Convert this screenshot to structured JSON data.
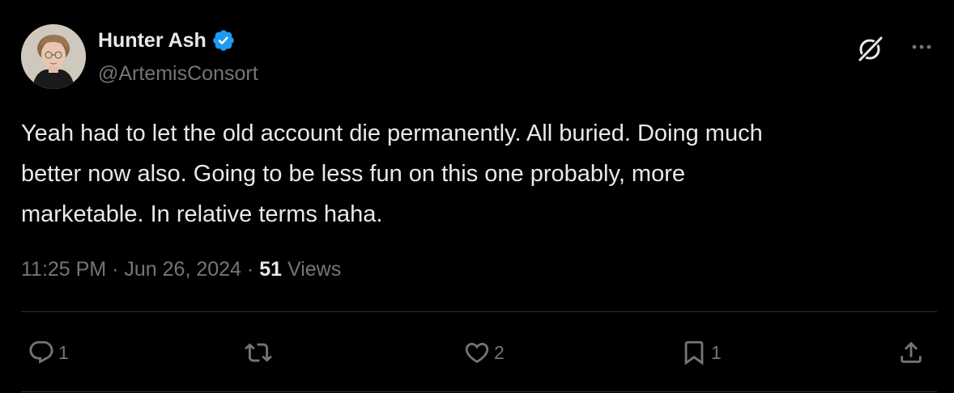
{
  "author": {
    "display_name": "Hunter Ash",
    "handle": "@ArtemisConsort",
    "verified": true
  },
  "tweet": {
    "text": "Yeah had to let the old account die permanently. All buried. Doing much\nbetter now also. Going to be less fun on this one probably, more\nmarketable. In relative terms haha.",
    "time": "11:25 PM",
    "date": "Jun 26, 2024",
    "views_count": "51",
    "views_label": "Views",
    "separator": "·"
  },
  "actions": {
    "reply_count": "1",
    "retweet_count": "",
    "like_count": "2",
    "bookmark_count": "1"
  },
  "icons": {
    "verified": "verified-badge-icon",
    "grok": "grok-icon",
    "more": "more-icon",
    "reply": "reply-icon",
    "retweet": "retweet-icon",
    "like": "heart-icon",
    "bookmark": "bookmark-icon",
    "share": "share-icon"
  },
  "colors": {
    "background": "#000000",
    "primary_text": "#e7e9ea",
    "secondary_text": "#71767b",
    "verified_blue": "#1d9bf0",
    "divider": "#2f3336"
  }
}
